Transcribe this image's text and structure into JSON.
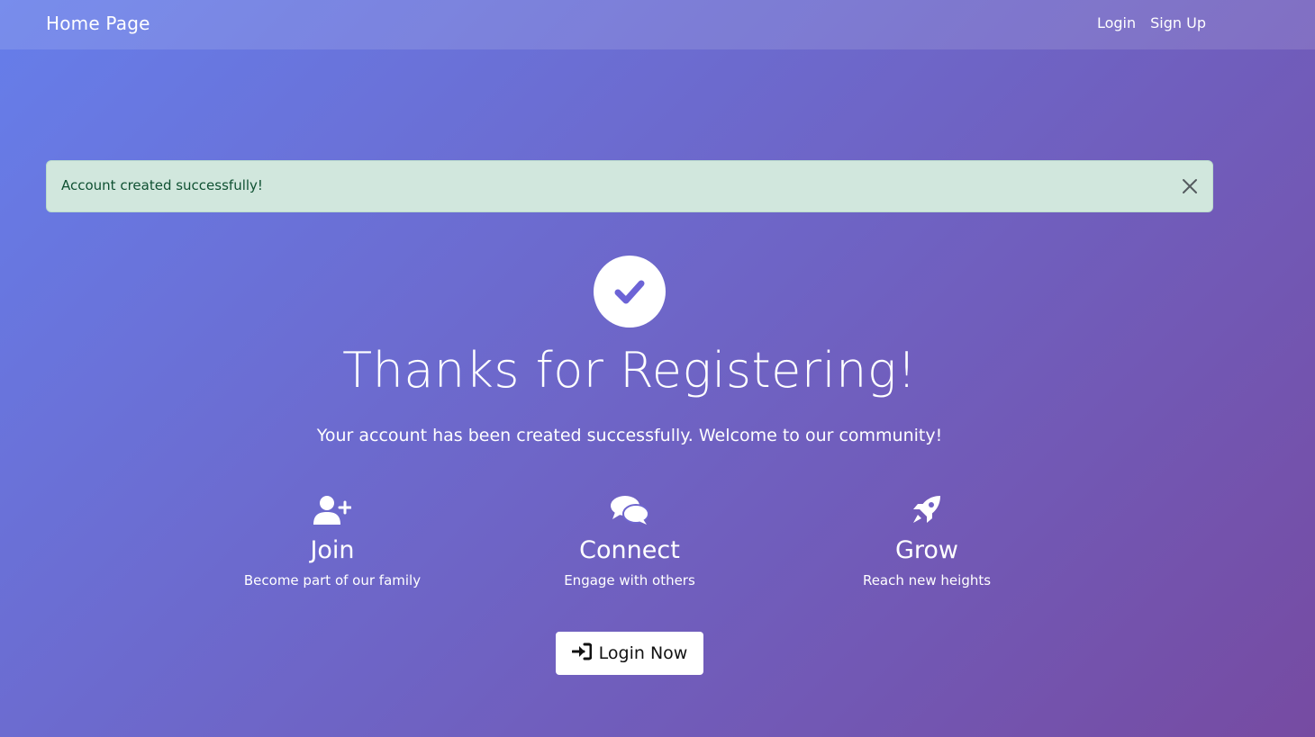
{
  "navbar": {
    "brand": "Home Page",
    "links": [
      {
        "label": "Login"
      },
      {
        "label": "Sign Up"
      }
    ]
  },
  "alert": {
    "message": "Account created successfully!",
    "close_icon": "close-icon"
  },
  "hero": {
    "icon": "check-circle-icon",
    "title": "Thanks for Registering!",
    "subtitle": "Your account has been created successfully. Welcome to our community!"
  },
  "features": [
    {
      "icon": "user-plus-icon",
      "title": "Join",
      "description": "Become part of our family"
    },
    {
      "icon": "comments-icon",
      "title": "Connect",
      "description": "Engage with others"
    },
    {
      "icon": "rocket-icon",
      "title": "Grow",
      "description": "Reach new heights"
    }
  ],
  "cta": {
    "icon": "sign-in-icon",
    "label": "Login Now"
  },
  "colors": {
    "gradient_start": "#667eea",
    "gradient_end": "#764ba2",
    "alert_bg": "#d1e7dd",
    "alert_text": "#0f5132",
    "check_color": "#6c63d6"
  }
}
